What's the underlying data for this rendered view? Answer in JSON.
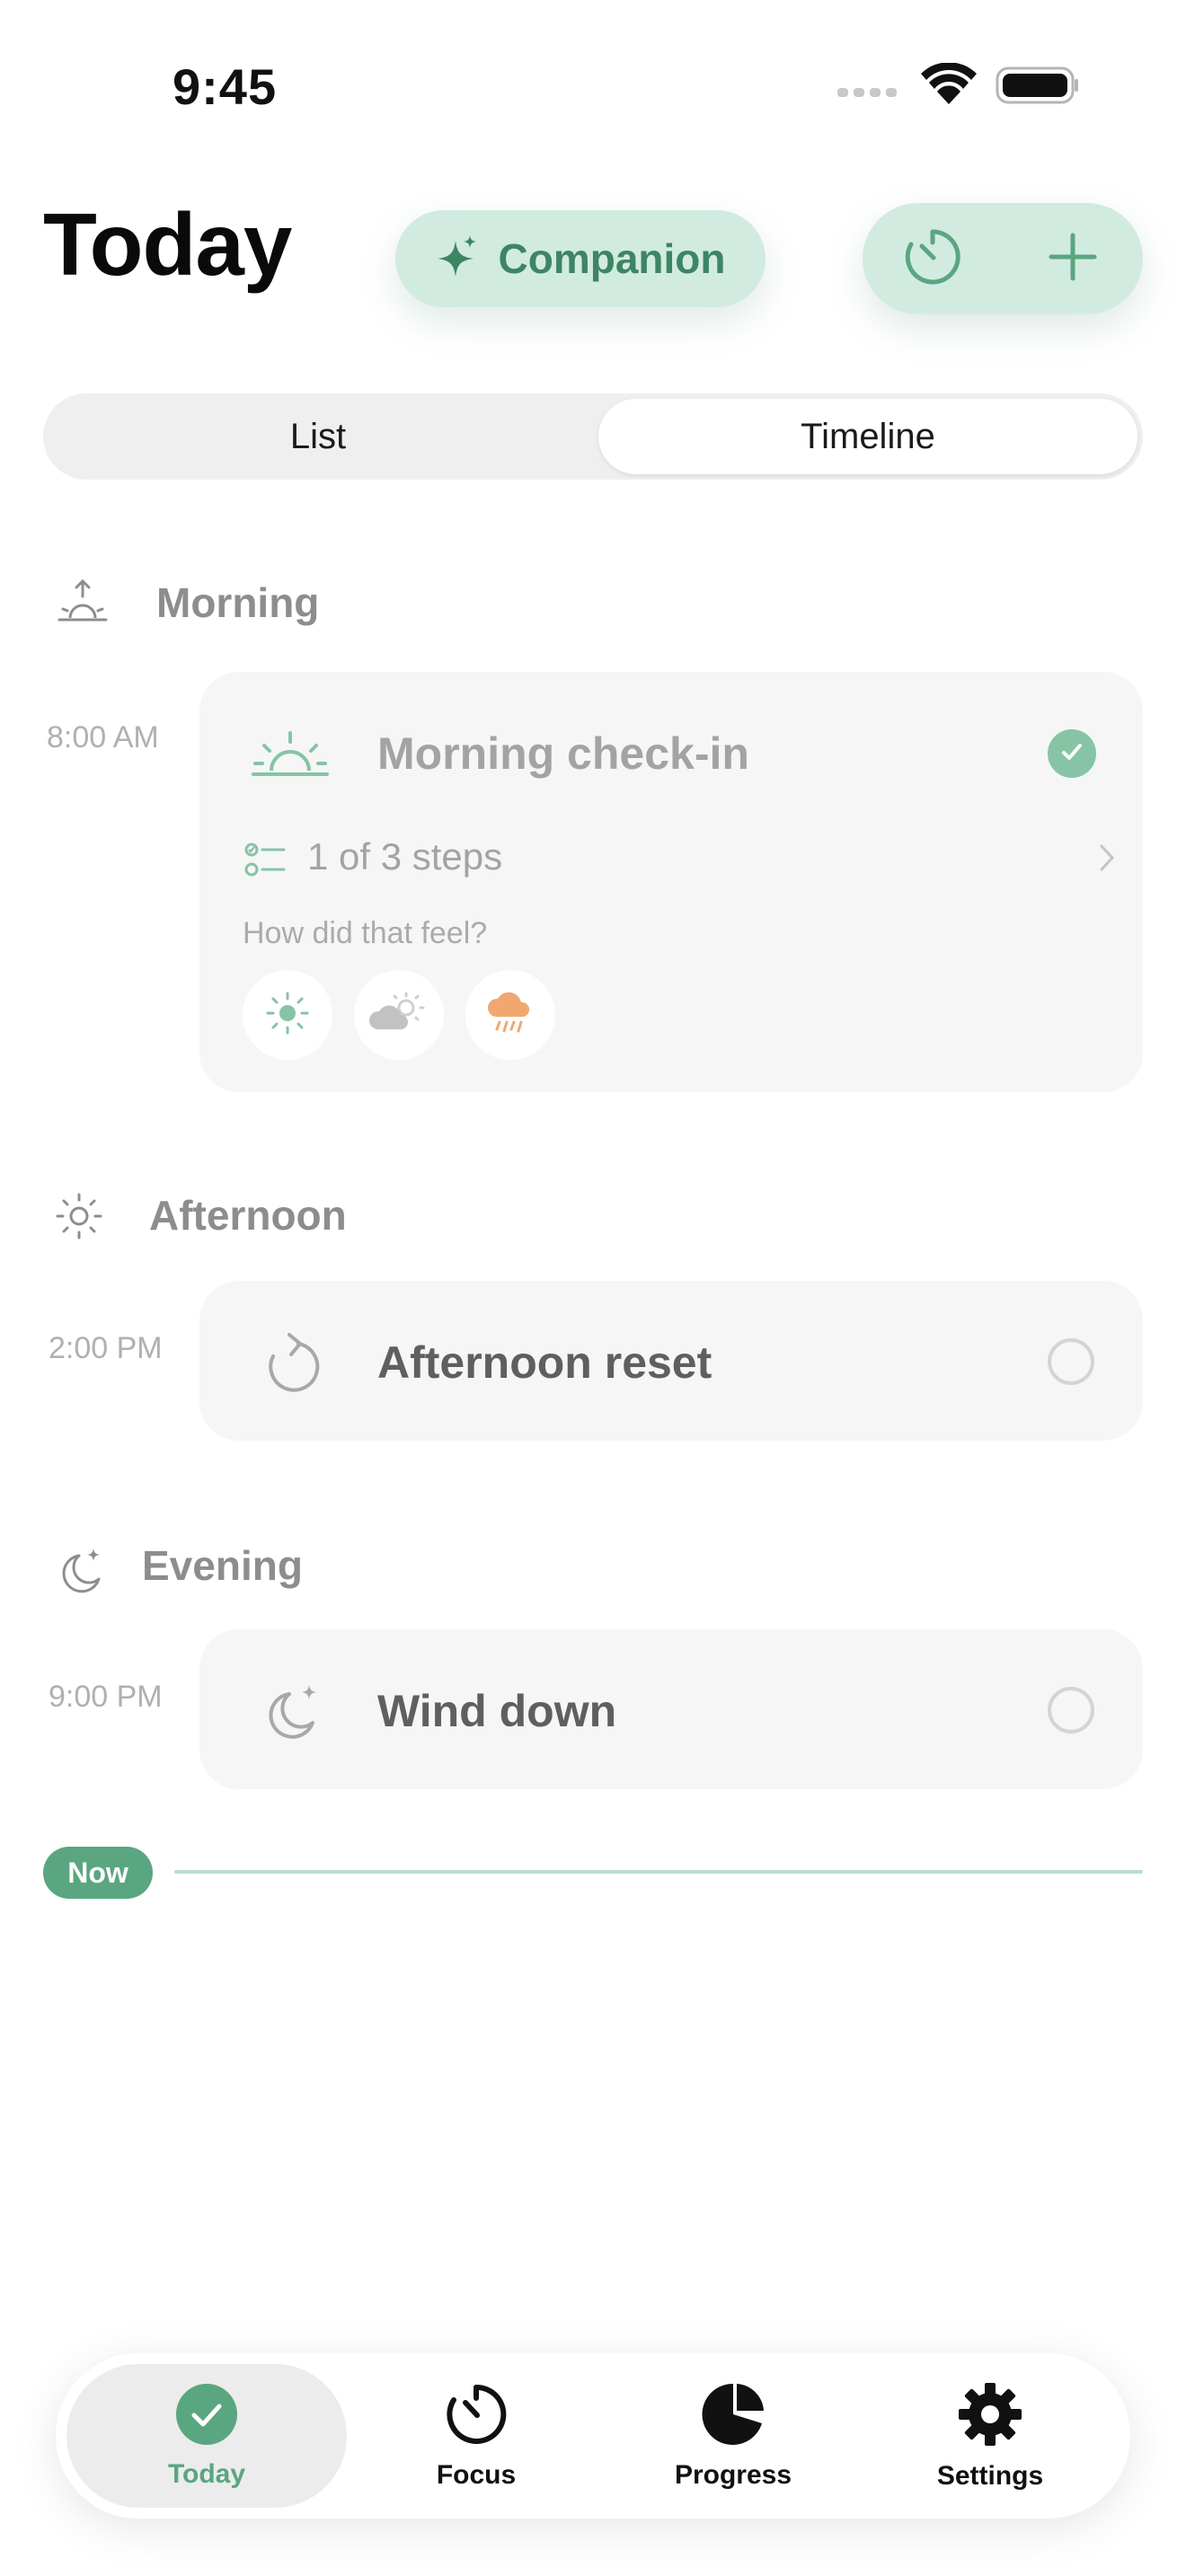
{
  "status_bar": {
    "time": "9:45"
  },
  "header": {
    "title": "Today",
    "companion_label": "Companion"
  },
  "view_toggle": {
    "options": [
      "List",
      "Timeline"
    ],
    "selected": "Timeline"
  },
  "sections": [
    {
      "name": "Morning",
      "time": "8:00 AM",
      "task": {
        "title": "Morning check-in",
        "done": true,
        "steps": "1 of 3 steps",
        "feel_prompt": "How did that feel?",
        "mood_options": [
          "sunny-icon",
          "partly-cloudy-icon",
          "rain-cloud-icon"
        ]
      }
    },
    {
      "name": "Afternoon",
      "time": "2:00 PM",
      "task": {
        "title": "Afternoon reset",
        "done": false
      }
    },
    {
      "name": "Evening",
      "time": "9:00 PM",
      "task": {
        "title": "Wind down",
        "done": false
      }
    }
  ],
  "now_label": "Now",
  "tabs": [
    {
      "label": "Today",
      "icon": "check-circle-icon",
      "active": true
    },
    {
      "label": "Focus",
      "icon": "timer-icon",
      "active": false
    },
    {
      "label": "Progress",
      "icon": "pie-chart-icon",
      "active": false
    },
    {
      "label": "Settings",
      "icon": "gear-icon",
      "active": false
    }
  ],
  "colors": {
    "accent": "#5aa680",
    "accent_light": "#d2ebe0",
    "accent_text": "#3d8565",
    "card_bg": "#f6f6f7",
    "mood_rain": "#f0a870"
  }
}
